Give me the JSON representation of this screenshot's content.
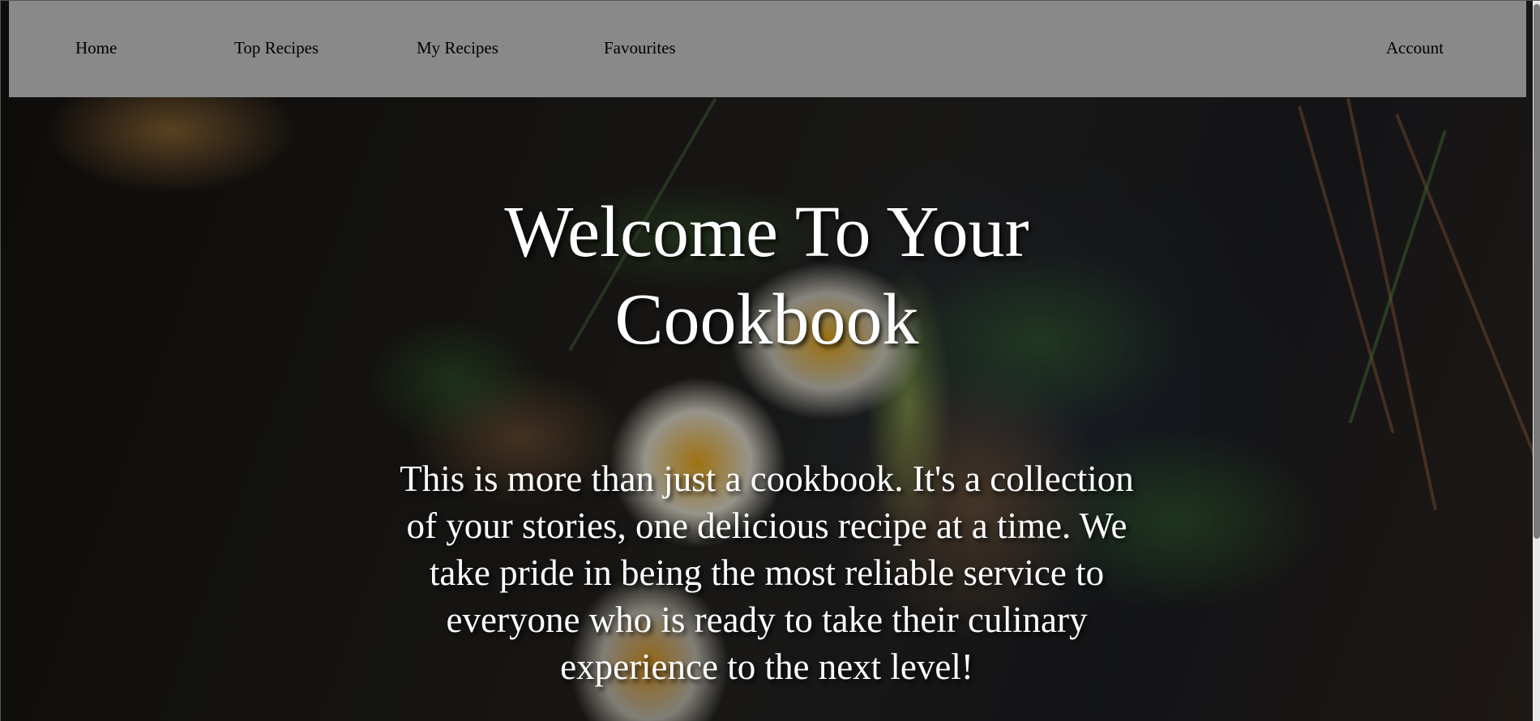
{
  "navbar": {
    "items": [
      {
        "label": "Home"
      },
      {
        "label": "Top Recipes"
      },
      {
        "label": "My Recipes"
      },
      {
        "label": "Favourites"
      }
    ],
    "account_label": "Account"
  },
  "hero": {
    "title": "Welcome To Your Cookbook",
    "text": "This is more than just a cookbook. It's a collection of your stories, one delicious recipe at a time. We take pride in being the most reliable service to everyone who is ready to take their culinary experience to the next level!",
    "background_image": "food-photo-eggs-avocado-spinach-toast"
  },
  "colors": {
    "navbar_bg": "#898989",
    "nav_text": "#000000",
    "hero_text": "#ffffff"
  }
}
